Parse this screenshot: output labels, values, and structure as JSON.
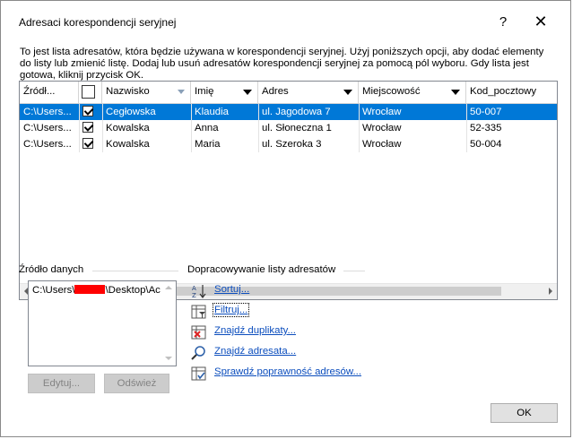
{
  "dialog": {
    "title": "Adresaci korespondencji seryjnej",
    "help": "?",
    "close": "✕",
    "description": "To jest lista adresatów, która będzie używana w korespondencji seryjnej. Użyj poniższych opcji, aby dodać elementy do listy lub zmienić listę. Dodaj lub usuń adresatów korespondencji seryjnej za pomocą pól wyboru. Gdy lista jest gotowa, kliknij przycisk OK."
  },
  "grid": {
    "columns": [
      {
        "label": "Źródł..."
      },
      {
        "label": ""
      },
      {
        "label": "Nazwisko"
      },
      {
        "label": "Imię"
      },
      {
        "label": "Adres"
      },
      {
        "label": "Miejscowość"
      },
      {
        "label": "Kod_pocztowy"
      }
    ],
    "rows": [
      {
        "source": "C:\\Users...",
        "checked": true,
        "surname": "Cegłowska",
        "name": "Klaudia",
        "address": "ul. Jagodowa 7",
        "city": "Wrocław",
        "zip": "50-007"
      },
      {
        "source": "C:\\Users...",
        "checked": true,
        "surname": "Kowalska",
        "name": "Anna",
        "address": "ul. Słoneczna 1",
        "city": "Wrocław",
        "zip": "52-335"
      },
      {
        "source": "C:\\Users...",
        "checked": true,
        "surname": "Kowalska",
        "name": "Maria",
        "address": "ul. Szeroka 3",
        "city": "Wrocław",
        "zip": "50-004"
      }
    ]
  },
  "source_group": {
    "label": "Źródło danych",
    "item_prefix": "C:\\Users\\",
    "item_suffix": "\\Desktop\\Ac",
    "edit_button": "Edytuj...",
    "refresh_button": "Odśwież"
  },
  "refine_group": {
    "label": "Dopracowywanie listy adresatów",
    "links": [
      {
        "label": "Sortuj...",
        "icon": "sort-az-icon"
      },
      {
        "label": "Filtruj...",
        "icon": "filter-icon"
      },
      {
        "label": "Znajdź duplikaty...",
        "icon": "duplicates-icon"
      },
      {
        "label": "Znajdź adresata...",
        "icon": "find-recipient-icon"
      },
      {
        "label": "Sprawdź poprawność adresów...",
        "icon": "validate-address-icon"
      }
    ]
  },
  "ok_button": "OK",
  "colors": {
    "selection": "#0078d7",
    "link": "#0b4dbd",
    "redaction": "#ff0000"
  }
}
